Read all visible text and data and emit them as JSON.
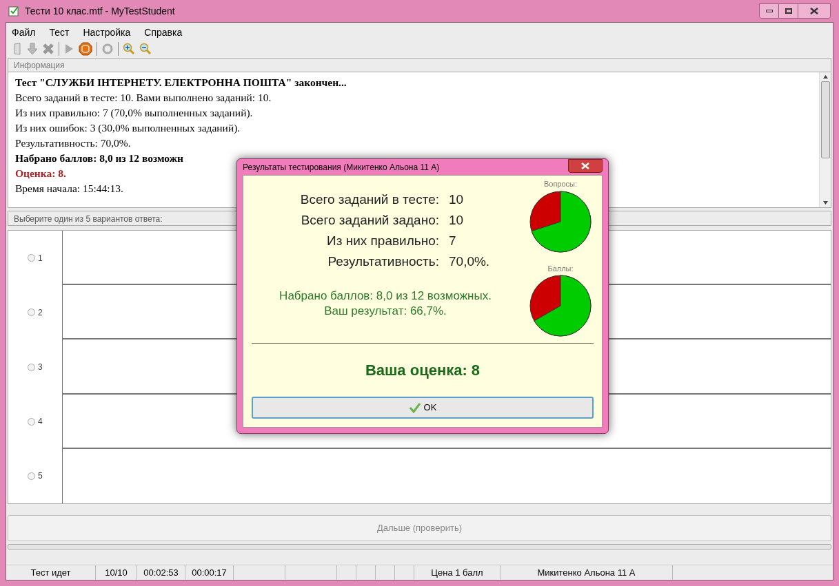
{
  "window": {
    "title": "Тести 10 клас.mtf - MyTestStudent"
  },
  "menu": [
    "Файл",
    "Тест",
    "Настройка",
    "Справка"
  ],
  "info_panel": {
    "title": "Информация",
    "lines": [
      {
        "kind": "bold",
        "text": "Тест \"СЛУЖБИ ІНТЕРНЕТУ. ЕЛЕКТРОННА ПОШТА\" закончен..."
      },
      {
        "kind": "normal",
        "text": "Всего заданий в тесте: 10. Вами выполнено заданий: 10."
      },
      {
        "kind": "normal",
        "text": "Из них правильно: 7 (70,0% выполненных заданий)."
      },
      {
        "kind": "normal",
        "text": "Из них ошибок: 3 (30,0% выполненных заданий)."
      },
      {
        "kind": "normal",
        "text": "Результативность: 70,0%."
      },
      {
        "kind": "bold",
        "text": "Набрано баллов: 8,0 из 12 возможн"
      },
      {
        "kind": "grade",
        "text": "Оценка: 8."
      },
      {
        "kind": "normal",
        "text": "Время начала: 15:44:13."
      }
    ]
  },
  "answers": {
    "title": "Выберите один из 5 вариантов ответа:",
    "options": [
      {
        "label": "1",
        "selected": false
      },
      {
        "label": "2",
        "selected": false
      },
      {
        "label": "3",
        "selected": false
      },
      {
        "label": "4",
        "selected": false
      },
      {
        "label": "5",
        "selected": false
      }
    ]
  },
  "next_button": {
    "label": "Дальше (проверить)",
    "disabled": true
  },
  "status_bar": {
    "left": [
      "Тест идет",
      "10/10",
      "00:02:53",
      "00:00:17"
    ],
    "right": [
      "Цена 1 балл",
      "Микитенко Альона 11 А"
    ]
  },
  "dialog": {
    "title": "Результаты тестирования (Микитенко Альона 11 А)",
    "stats": [
      {
        "label": "Всего заданий в тесте:",
        "value": "10"
      },
      {
        "label": "Всего заданий задано:",
        "value": "10"
      },
      {
        "label": "Из них правильно:",
        "value": "7"
      },
      {
        "label": "Результативность:",
        "value": "70,0%."
      }
    ],
    "score_lines": [
      "Набрано баллов: 8,0 из 12 возможных.",
      "Ваш результат: 66,7%."
    ],
    "pie_titles": [
      "Вопросы:",
      "Баллы:"
    ],
    "grade": "Ваша оценка: 8",
    "ok_button": "OK"
  }
}
